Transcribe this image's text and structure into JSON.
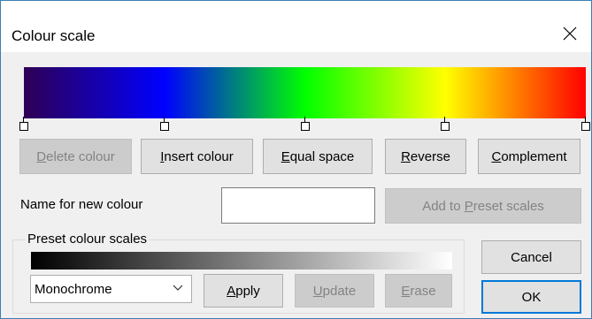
{
  "window": {
    "title": "Colour scale",
    "close_icon": "close-icon"
  },
  "colour_bar": {
    "stops": [
      "#2e0054",
      "#0000ff",
      "#00ff00",
      "#ffff00",
      "#ff0000"
    ],
    "stop_positions": [
      0,
      0.25,
      0.5,
      0.75,
      1.0
    ]
  },
  "edit_buttons": {
    "delete": {
      "label": "Delete colour",
      "underline": "D",
      "enabled": false
    },
    "insert": {
      "label": "Insert colour",
      "underline": "I",
      "enabled": true
    },
    "equal": {
      "label": "Equal space",
      "underline": "E",
      "enabled": true
    },
    "reverse": {
      "label": "Reverse",
      "underline": "R",
      "enabled": true
    },
    "complement": {
      "label": "Complement",
      "underline": "C",
      "enabled": true
    }
  },
  "new_colour": {
    "label": "Name for new colour",
    "value": "",
    "add_button": {
      "label": "Add to Preset scales",
      "enabled": false
    }
  },
  "preset": {
    "group_label": "Preset colour scales",
    "gradient_start": "#000000",
    "gradient_end": "#ffffff",
    "selected": "Monochrome",
    "apply": {
      "label": "Apply",
      "enabled": true
    },
    "update": {
      "label": "Update",
      "enabled": false
    },
    "erase": {
      "label": "Erase",
      "enabled": false
    }
  },
  "dialog_buttons": {
    "cancel": "Cancel",
    "ok": "OK"
  },
  "colors": {
    "accent": "#0078d7",
    "window_border": "#3c7fb1",
    "disabled_text": "#838383"
  }
}
